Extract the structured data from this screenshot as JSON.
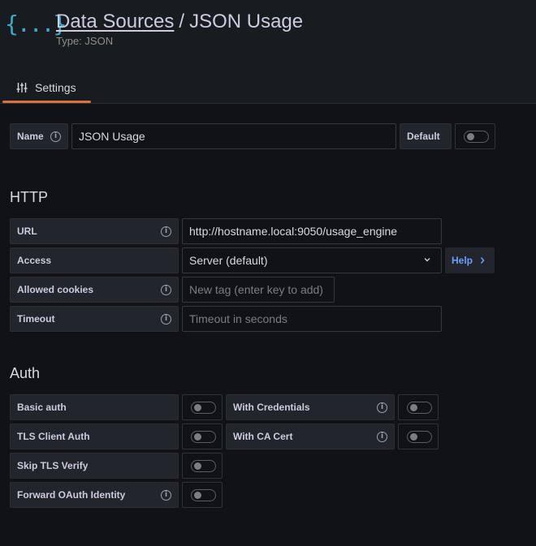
{
  "header": {
    "logo": "{...}",
    "breadcrumb": "Data Sources",
    "separator": "/",
    "title": "JSON Usage",
    "subtitle": "Type: JSON"
  },
  "tabs": [
    {
      "label": "Settings",
      "icon": "sliders-icon",
      "active": true
    }
  ],
  "name_row": {
    "label": "Name",
    "value": "JSON Usage",
    "default_label": "Default",
    "default_on": false
  },
  "http": {
    "title": "HTTP",
    "url_label": "URL",
    "url_value": "http://hostname.local:9050/usage_engine",
    "access_label": "Access",
    "access_value": "Server (default)",
    "help_label": "Help",
    "cookies_label": "Allowed cookies",
    "cookies_placeholder": "New tag (enter key to add)",
    "timeout_label": "Timeout",
    "timeout_placeholder": "Timeout in seconds"
  },
  "auth": {
    "title": "Auth",
    "basic_auth": "Basic auth",
    "with_credentials": "With Credentials",
    "tls_client_auth": "TLS Client Auth",
    "with_ca_cert": "With CA Cert",
    "skip_tls_verify": "Skip TLS Verify",
    "forward_oauth": "Forward OAuth Identity"
  },
  "colors": {
    "accent": "#e16f3a",
    "logo": "#3fa9c6",
    "link": "#6e9fff",
    "background": "#111217",
    "panel": "#22252b"
  }
}
